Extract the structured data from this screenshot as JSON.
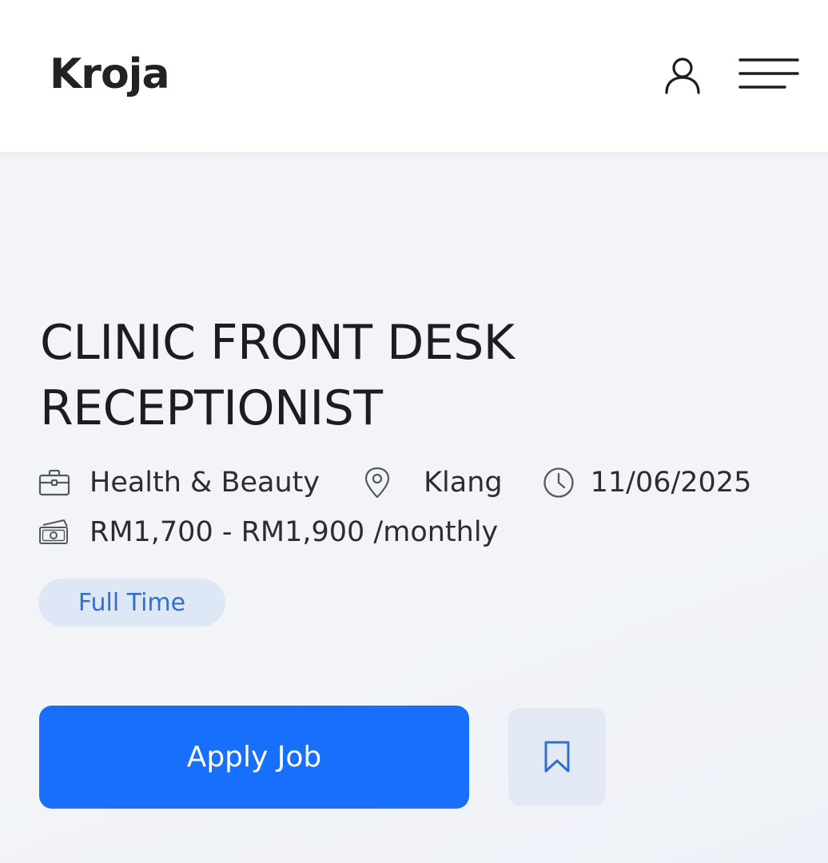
{
  "brand": {
    "name": "Kroja"
  },
  "header": {
    "user_icon": "user-icon",
    "menu_icon": "hamburger-menu-icon"
  },
  "job": {
    "title": "CLINIC FRONT DESK RECEPTIONIST",
    "category": "Health & Beauty",
    "location": "Klang",
    "date": "11/06/2025",
    "salary": "RM1,700 - RM1,900 /monthly",
    "employment_type": "Full Time"
  },
  "icons": {
    "category": "briefcase-icon",
    "location": "map-pin-icon",
    "date": "clock-icon",
    "salary": "money-icon",
    "bookmark": "bookmark-icon"
  },
  "actions": {
    "apply_label": "Apply Job"
  },
  "colors": {
    "primary": "#176ffb",
    "badge_bg": "#dde7f6",
    "badge_text": "#2f6fcf",
    "background": "#f2f4f8",
    "header_bg": "#ffffff"
  }
}
